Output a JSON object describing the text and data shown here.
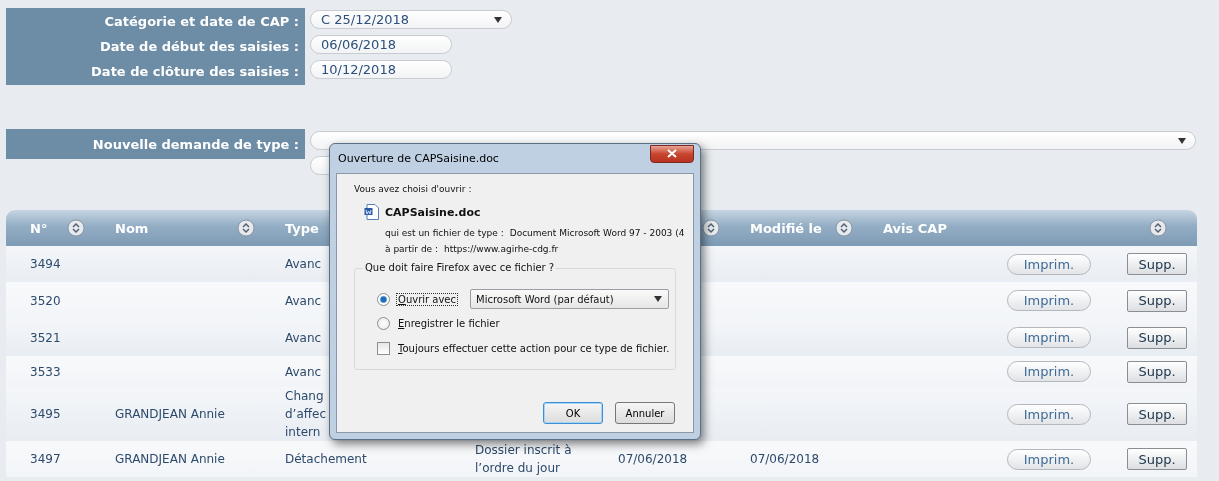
{
  "form": {
    "fields": [
      {
        "label": "Catégorie et date de CAP :",
        "kind": "select",
        "value": "C  25/12/2018"
      },
      {
        "label": "Date de début des saisies :",
        "kind": "text",
        "value": "06/06/2018"
      },
      {
        "label": "Date de clôture des saisies :",
        "kind": "text",
        "value": "10/12/2018"
      }
    ]
  },
  "new_request": {
    "label": "Nouvelle demande de type :"
  },
  "table": {
    "columns": [
      {
        "label": "N°",
        "sort_icon": true
      },
      {
        "label": "Nom",
        "sort_icon": true
      },
      {
        "label": "Type",
        "sort_icon": false
      },
      {},
      {
        "sort_icon": true
      },
      {
        "label": "Modifié le",
        "sort_icon": true
      },
      {
        "label": "Avis CAP",
        "sort_icon": true
      }
    ],
    "rows": [
      {
        "cells": [
          "3494",
          "",
          "Avanc",
          "",
          "",
          "",
          ""
        ],
        "actions": [
          {
            "kind": "print",
            "label": "Imprim."
          },
          {
            "kind": "delete",
            "label": "Supp."
          }
        ]
      },
      {
        "cells": [
          "3520",
          "",
          "Avanc",
          "",
          "",
          "",
          ""
        ],
        "actions": [
          {
            "kind": "print",
            "label": "Imprim."
          },
          {
            "kind": "delete",
            "label": "Supp."
          }
        ]
      },
      {
        "cells": [
          "3521",
          "",
          "Avanc",
          "",
          "",
          "",
          ""
        ],
        "actions": [
          {
            "kind": "print",
            "label": "Imprim."
          },
          {
            "kind": "delete",
            "label": "Supp."
          }
        ]
      },
      {
        "cells": [
          "3533",
          "",
          "Avanc",
          "",
          "",
          "",
          ""
        ],
        "actions": [
          {
            "kind": "print",
            "label": "Imprim."
          },
          {
            "kind": "delete",
            "label": "Supp."
          }
        ]
      },
      {
        "cells": [
          "3495",
          "GRANDJEAN Annie",
          "Chang\nd’affec\nintern",
          "",
          "",
          "",
          ""
        ],
        "actions": [
          {
            "kind": "print",
            "label": "Imprim."
          },
          {
            "kind": "delete",
            "label": "Supp."
          }
        ]
      },
      {
        "cells": [
          "3497",
          "GRANDJEAN Annie",
          "Détachement",
          "Dossier inscrit à\nl’ordre du jour",
          "07/06/2018",
          "07/06/2018",
          ""
        ],
        "actions": [
          {
            "kind": "print",
            "label": "Imprim."
          },
          {
            "kind": "delete",
            "label": "Supp."
          }
        ]
      }
    ]
  },
  "dialog": {
    "title": "Ouverture de CAPSaisine.doc",
    "intro": "Vous avez choisi d'ouvrir :",
    "file_name": "CAPSaisine.doc",
    "type_label": "qui est un fichier de type :",
    "type_value": "Document Microsoft Word 97 - 2003 (4",
    "from_label": "à partir de :",
    "from_value": "https://www.agirhe-cdg.fr",
    "group_label": "Que doit faire Firefox avec ce fichier ?",
    "options": [
      {
        "kind": "radio",
        "label": "Ouvrir avec",
        "selected": true,
        "app": "Microsoft Word (par défaut)"
      },
      {
        "kind": "radio",
        "label": "Enregistrer le fichier",
        "selected": false
      },
      {
        "kind": "checkbox",
        "label": "Toujours effectuer cette action pour ce type de fichier.",
        "checked": false
      }
    ],
    "buttons": [
      {
        "label": "OK",
        "default": true
      },
      {
        "label": "Annuler",
        "default": false
      }
    ]
  }
}
